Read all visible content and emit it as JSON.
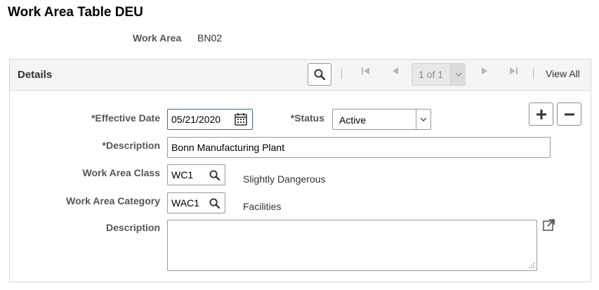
{
  "page": {
    "title": "Work Area Table DEU"
  },
  "key": {
    "label": "Work Area",
    "value": "BN02"
  },
  "details": {
    "title": "Details",
    "nav": {
      "page_indicator": "1 of 1",
      "view_all": "View All"
    },
    "effective_date": {
      "label": "*Effective Date",
      "value": "05/21/2020"
    },
    "status": {
      "label": "*Status",
      "value": "Active"
    },
    "description": {
      "label": "*Description",
      "value": "Bonn Manufacturing Plant"
    },
    "work_area_class": {
      "label": "Work Area Class",
      "value": "WC1",
      "description": "Slightly Dangerous"
    },
    "work_area_category": {
      "label": "Work Area Category",
      "value": "WAC1",
      "description": "Facilities"
    },
    "long_description": {
      "label": "Description",
      "value": ""
    }
  },
  "icons": {
    "search": "search-icon",
    "calendar": "calendar-icon",
    "add": "plus-icon",
    "remove": "minus-icon",
    "expand": "expand-icon"
  }
}
